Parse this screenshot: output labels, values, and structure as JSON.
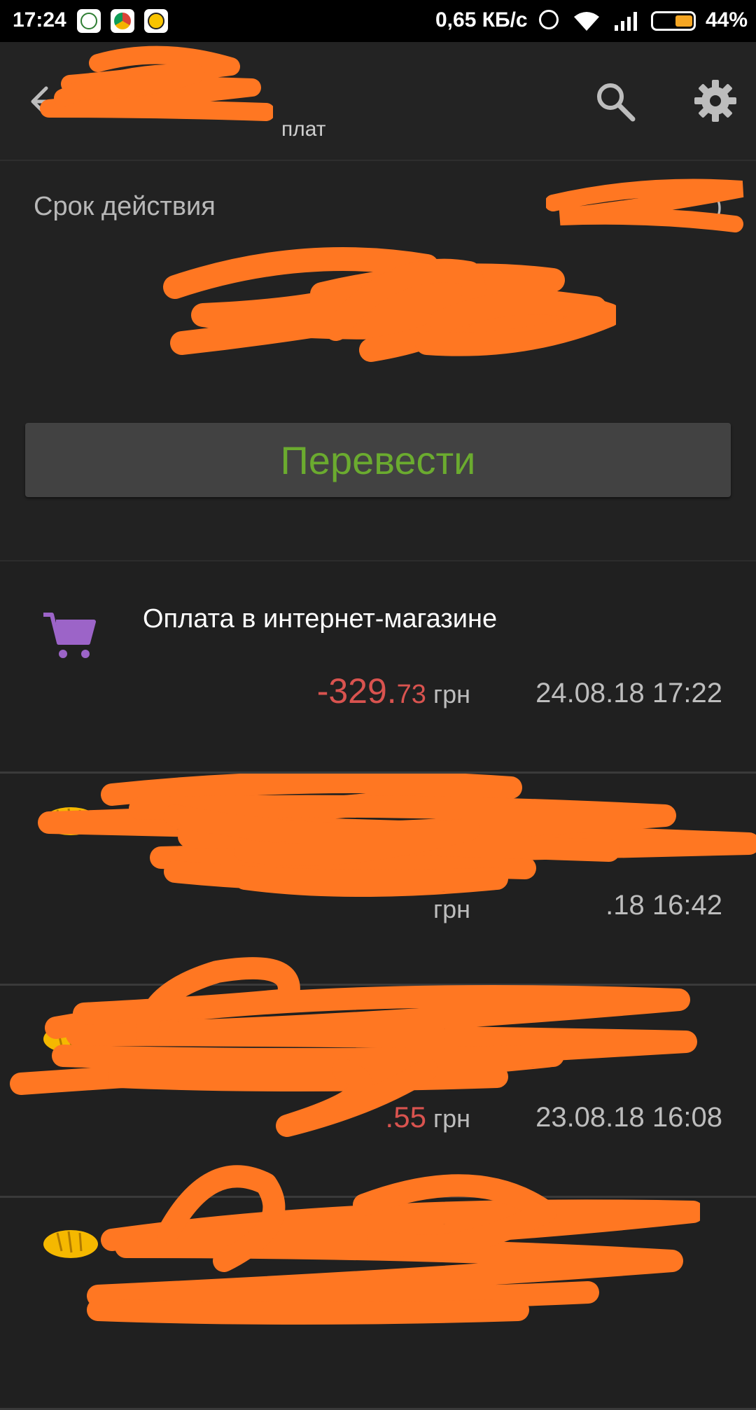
{
  "status_bar": {
    "time": "17:24",
    "notification_icons": [
      "24-channel-icon",
      "chrome-icon",
      "app-icon"
    ],
    "network_speed": "0,65 КБ/с",
    "battery_percent": "44%",
    "battery_level": 0.44
  },
  "toolbar": {
    "title": "",
    "subtitle": "плат"
  },
  "summary": {
    "valid_label": "Срок действия",
    "valid_value": ")",
    "balance": "",
    "transfer_button": "Перевести"
  },
  "transactions": [
    {
      "icon": "cart-icon",
      "title": "Оплата в интернет-магазине",
      "amount_int": "-329.",
      "amount_dec": "73",
      "currency": "грн",
      "date": "24.08.18 17:22"
    },
    {
      "icon": "bread-icon",
      "title": "",
      "amount_int": "",
      "amount_dec": "",
      "currency": "грн",
      "date": ".18 16:42"
    },
    {
      "icon": "bread-icon",
      "title": "",
      "amount_int": "",
      "amount_dec": ".55",
      "currency": "грн",
      "date": "23.08.18 16:08"
    },
    {
      "icon": "bread-icon",
      "title": "",
      "amount_int": "",
      "amount_dec": "",
      "currency": "",
      "date": ""
    }
  ],
  "colors": {
    "accent_green": "#5aa02c",
    "negative_red": "#d9534f",
    "redaction_orange": "#ff7722",
    "cart_purple": "#9c64c8",
    "bread_yellow": "#f5b800"
  }
}
